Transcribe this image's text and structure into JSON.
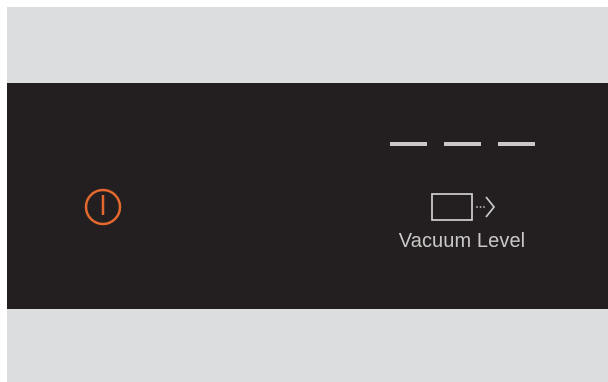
{
  "colors": {
    "frame": "#dcdddf",
    "panel": "#231f20",
    "power_icon": "#e3692f",
    "indicator": "#c9c8c6"
  },
  "power": {
    "icon": "power-icon"
  },
  "vacuum_level": {
    "label": "Vacuum Level",
    "icon": "vacuum-seal-icon",
    "indicators_total": 3
  }
}
